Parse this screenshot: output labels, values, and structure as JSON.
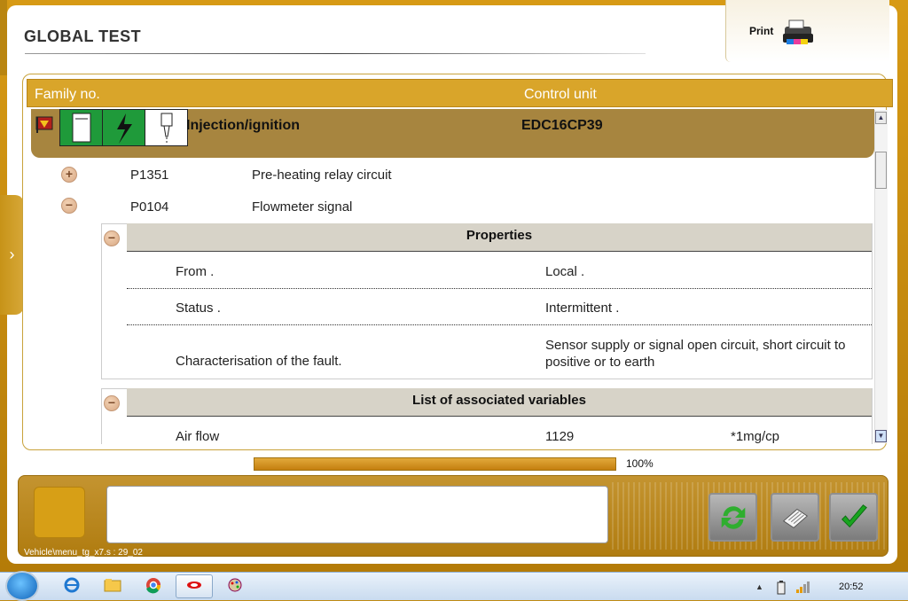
{
  "header": {
    "title": "GLOBAL TEST",
    "print_label": "Print",
    "printer_icon": "printer-icon"
  },
  "columns": {
    "family": "Family no.",
    "control_unit": "Control unit"
  },
  "family_row": {
    "name": "Injection/ignition",
    "ecu": "EDC16CP39"
  },
  "faults": [
    {
      "code": "P1351",
      "description": "Pre-heating relay circuit",
      "state": "collapsed"
    },
    {
      "code": "P0104",
      "description": "Flowmeter signal",
      "state": "expanded"
    }
  ],
  "properties": {
    "title": "Properties",
    "rows": [
      {
        "label": "From .",
        "value": "Local ."
      },
      {
        "label": "Status .",
        "value": "Intermittent ."
      },
      {
        "label": "Characterisation of the fault.",
        "value": "Sensor supply or signal open circuit, short circuit to positive or to earth"
      }
    ]
  },
  "variables": {
    "title": "List of associated variables",
    "rows": [
      {
        "name": "Air flow",
        "value": "1129",
        "unit": "*1mg/cp"
      }
    ]
  },
  "progress": {
    "percent": 100,
    "label": "100%"
  },
  "footer": {
    "path": "Vehicle\\menu_tg_x7.s : 29_02"
  },
  "taskbar": {
    "clock": "20:52"
  },
  "colors": {
    "frame": "#c08a10",
    "header_bar": "#d9a52a",
    "family_row": "#a7853f"
  }
}
